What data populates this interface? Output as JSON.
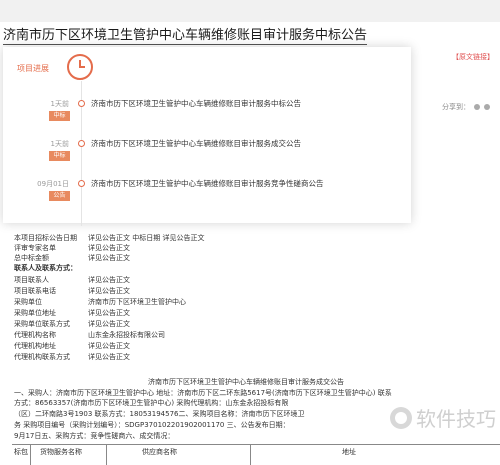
{
  "header": {
    "title": "济南市历下区环境卫生管护中心车辆维修账目审计服务中标公告",
    "original_link": "【原文链接】",
    "share_label": "分享到："
  },
  "timeline": {
    "heading": "项目进展",
    "items": [
      {
        "time": "1天前",
        "badge": "中标",
        "text": "济南市历下区环境卫生管护中心车辆维修账目审计服务中标公告"
      },
      {
        "time": "1天前",
        "badge": "中标",
        "text": "济南市历下区环境卫生管护中心车辆维修账目审计服务成交公告"
      },
      {
        "time": "09月01日",
        "badge": "公告",
        "text": "济南市历下区环境卫生管护中心车辆维修账目审计服务竞争性磋商公告"
      }
    ]
  },
  "document": {
    "rows": [
      {
        "label": "本项目招标公告日期",
        "value": "详见公告正文    中标日期   详见公告正文"
      },
      {
        "label": "评审专家名单",
        "value": "详见公告正文"
      },
      {
        "label": "总中标金额",
        "value": "详见公告正文"
      },
      {
        "label": "联系人及联系方式：",
        "value": "",
        "bold": true
      },
      {
        "label": "项目联系人",
        "value": "详见公告正文"
      },
      {
        "label": "项目联系电话",
        "value": "详见公告正文"
      },
      {
        "label": "采购单位",
        "value": "济南市历下区环境卫生管护中心"
      },
      {
        "label": "采购单位地址",
        "value": "详见公告正文"
      },
      {
        "label": "采购单位联系方式",
        "value": "详见公告正文"
      },
      {
        "label": "代理机构名称",
        "value": "山东金永招投标有限公司"
      },
      {
        "label": "代理机构地址",
        "value": "详见公告正文"
      },
      {
        "label": "代理机构联系方式",
        "value": "详见公告正文"
      }
    ],
    "notice_title": "济南市历下区环境卫生管护中心车辆维修账目审计服务成交公告",
    "paragraphs": [
      "一、采购人：济南市历下区环境卫生管护中心    地址：济南市历下区二环东路5617号(济南市历下区环境卫生管护中心)    联系",
      "方式：86563357(济南市历下区环境卫生管护中心)     采购代理机构：山东金永招投标有限",
      "（区）二环南路3号1903     联系方式：18053194576二、采购项目名称：济南市历下区环境卫",
      "务   采购项目编号（采购计划编号）：SDGP370102201902001170 三、公告发布日期：",
      "9月17日五、采购方式：竞争性磋商六、成交情况："
    ],
    "table_headers": [
      "标包",
      "货物服务名称",
      "供应商名称",
      "地址"
    ]
  },
  "watermark": "软件技巧"
}
